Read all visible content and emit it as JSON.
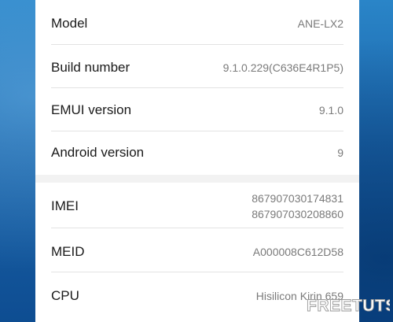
{
  "device_info": {
    "rows_top": [
      {
        "label": "Model",
        "value": "ANE-LX2"
      },
      {
        "label": "Build number",
        "value": "9.1.0.229(C636E4R1P5)"
      },
      {
        "label": "EMUI version",
        "value": "9.1.0"
      },
      {
        "label": "Android version",
        "value": "9"
      }
    ],
    "imei": {
      "label": "IMEI",
      "value_1": "867907030174831",
      "value_2": "867907030208860"
    },
    "meid": {
      "label": "MEID",
      "value": "A000008C612D58"
    },
    "cpu": {
      "label": "CPU",
      "value": "Hisilicon Kirin 659"
    }
  },
  "watermark": {
    "text": "FREETUTS"
  },
  "colors": {
    "label": "#1a1a1a",
    "value": "#7a7a7a",
    "background": "#f2f2f2",
    "card": "#ffffff",
    "wallpaper": "#1d6fb3"
  }
}
